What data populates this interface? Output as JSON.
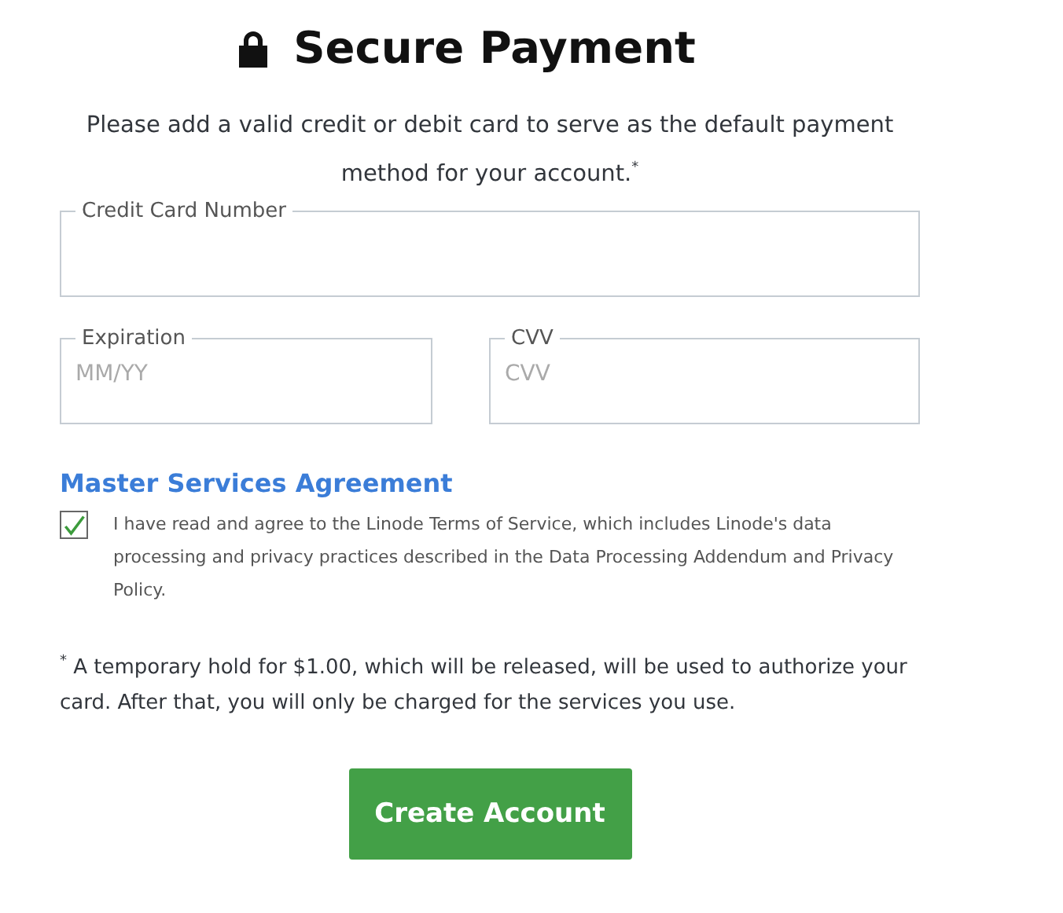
{
  "title": "Secure Payment",
  "intro": "Please add a valid credit or debit card to serve as the default payment method for your account.$^{*}$",
  "fields": [
    {
      "label": "Credit Card Number",
      "kind": "wide"
    },
    {
      "label": "Expiration",
      "placeholder": "MM/YY",
      "kind": "half"
    },
    {
      "label": "CVV",
      "placeholder": "CVV",
      "kind": "half"
    }
  ],
  "agreement": {
    "heading": "Master Services Agreement",
    "checked": true,
    "text": "I have read and agree to the Linode Terms of Service, which includes Linode's data processing and privacy practices described in the Data Processing Addendum and Privacy Policy."
  },
  "footnote": "$^{*}$ A temporary hold for $1.00, which will be released, will be used to authorize your card. After that, you will only be charged for the services you use.",
  "button": "Create Account"
}
